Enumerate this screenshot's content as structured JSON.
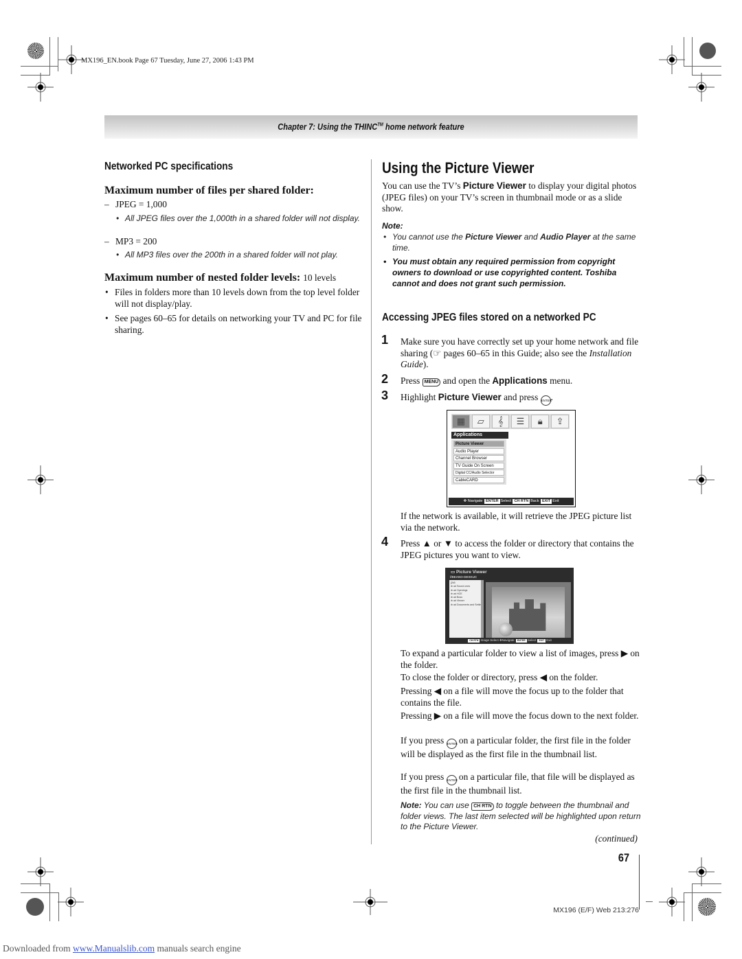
{
  "header": {
    "book_line": "MX196_EN.book  Page 67  Tuesday, June 27, 2006  1:43 PM",
    "chapter_prefix": "Chapter 7: Using the THINC",
    "chapter_tm": "TM",
    "chapter_suffix": " home network feature"
  },
  "left": {
    "section_title": "Networked PC specifications",
    "max_files_heading": "Maximum number of files per shared folder:",
    "jpeg_limit": "JPEG = 1,000",
    "jpeg_note": "All JPEG files over the 1,000th in a shared folder will not display.",
    "mp3_limit": "MP3 = 200",
    "mp3_note": "All MP3 files over the 200th in a shared folder will not play.",
    "nested_heading": "Maximum number of nested folder levels:",
    "nested_value": "10 levels",
    "bullets": [
      "Files in folders more than 10 levels down from the top level folder will not display/play.",
      "See pages 60–65 for details on networking your TV and PC for file sharing."
    ]
  },
  "right": {
    "title": "Using the Picture Viewer",
    "intro_a": "You can use the TV’s ",
    "intro_bold": "Picture Viewer",
    "intro_b": " to display your digital photos (JPEG files) on your TV’s screen in thumbnail mode or as a slide show.",
    "note_label": "Note:",
    "note1_a": "You cannot use the ",
    "note1_b1": "Picture Viewer",
    "note1_c": " and ",
    "note1_b2": "Audio Player",
    "note1_d": " at the same time.",
    "note2": "You must obtain any required permission from copyright owners to download or use copyrighted content. Toshiba cannot and does not grant such permission.",
    "subsection_title": "Accessing JPEG files stored on a networked PC",
    "steps": [
      {
        "num": "1",
        "a": "Make sure you have correctly set up your home network and file sharing (",
        "icon": "☞",
        "b": " pages 60–65 in this Guide; also see the ",
        "italic": "Installation Guide",
        "c": ")."
      },
      {
        "num": "2",
        "a": "Press ",
        "key": "MENU",
        "b": " and open the ",
        "bold": "Applications",
        "c": " menu."
      },
      {
        "num": "3",
        "a": "Highlight ",
        "bold": "Picture Viewer",
        "b": " and press ",
        "key": "ENTER",
        "c": "."
      },
      {
        "num": "4",
        "a": "Press ▲ or ▼ to access the folder or directory that contains the JPEG pictures you want to view."
      }
    ],
    "after_step3": "If the network is available, it will retrieve the JPEG picture list via the network.",
    "para_expand": "To expand a particular folder to view a list of images, press ▶ on the folder.",
    "para_close": "To close the folder or directory, press ◀ on the folder.",
    "para_left": "Pressing ◀ on a file will move the focus up to the folder that contains the file.",
    "para_right": "Pressing ▶ on a file will move the focus down to the next folder.",
    "para_enter_folder_a": "If you press ",
    "para_enter_folder_b": " on a particular folder, the first file in the folder will be displayed as the first file in the thumbnail list.",
    "para_enter_file_a": "If you press ",
    "para_enter_file_b": " on a particular file, that file will be displayed as the first file in the thumbnail list.",
    "enter_key": "ENTER",
    "final_note_label": "Note:",
    "final_note_a": " You can use ",
    "final_note_key": "CH RTN",
    "final_note_b": " to toggle between the thumbnail and folder views. The last item selected will be highlighted upon return to the Picture Viewer.",
    "continued": "(continued)"
  },
  "screen1": {
    "icons": [
      "applications-icon",
      "screen-icon",
      "music-note-icon",
      "settings-icon",
      "lock-icon",
      "setup-icon"
    ],
    "header": "Applications",
    "items": [
      "Picture Viewer",
      "Audio Player",
      "Channel Browser",
      "TV Guide On Screen",
      "Digital CC/Audio Selector",
      "CableCARD"
    ],
    "selected_index": 0,
    "footer": {
      "navigate": "Navigate",
      "enter": "ENTER",
      "select": "Select",
      "chrtn": "CH RTN",
      "back": "Back",
      "exit_key": "EXIT",
      "exit": "Exit"
    }
  },
  "screen2": {
    "title": "Picture Viewer",
    "path": "//BEANO-DESKUC",
    "folders": [
      "j2k5",
      "⊕ ad Sound ones",
      "⊕ ad Openings",
      "⊕ ad HCE",
      "⊕ ad Boss",
      "⊕ ad Viewer",
      "⊕ ad Documents and Settings"
    ],
    "footer": {
      "image_key": "CH RTN",
      "image_select": "Image Select",
      "navigate": "Navigate",
      "enter": "ENTER",
      "select": "Select",
      "exit_key": "EXIT",
      "exit": "Exit"
    }
  },
  "footer": {
    "page_number": "67",
    "code": "MX196 (E/F) Web 213:276",
    "download_prefix": "Downloaded from ",
    "download_link": "www.Manualslib.com",
    "download_suffix": " manuals search engine"
  }
}
